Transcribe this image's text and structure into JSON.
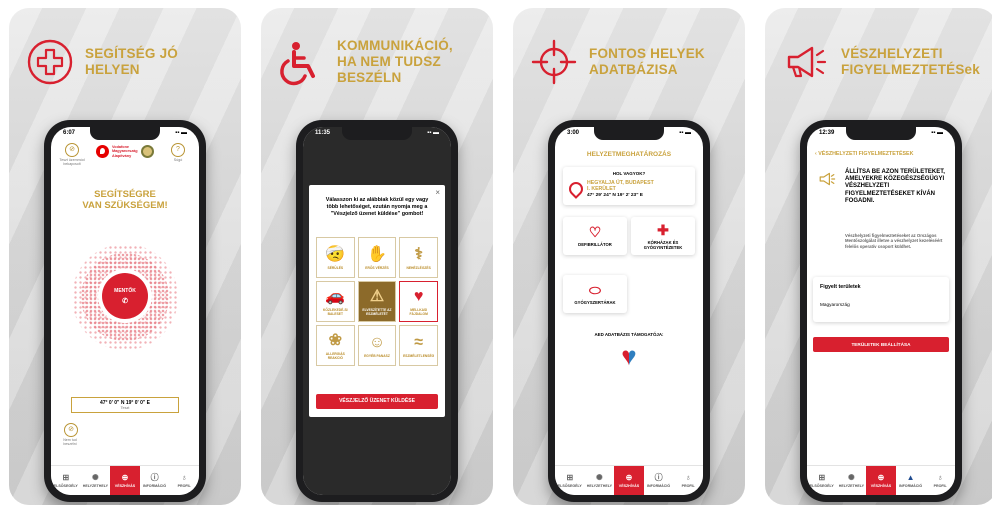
{
  "colors": {
    "gold": "#c9a23d",
    "red": "#d8202f",
    "dark": "#1d1d1f"
  },
  "panels": [
    {
      "title": "SEGÍTSÉG JÓ HELYEN",
      "icon": "first-aid-cross-icon"
    },
    {
      "title": "KOMMUNIKÁCIÓ,\nHA NEM TUDSZ\nBESZÉLN",
      "icon": "wheelchair-icon"
    },
    {
      "title": "FONTOS HELYEK\nADATBÁZISA",
      "icon": "crosshair-icon"
    },
    {
      "title": "VÉSZHELYZETI\nFIGYELMEZTETÉSek",
      "icon": "megaphone-icon"
    }
  ],
  "tabs": {
    "first": [
      "ELSŐSEGÉLY",
      "HELYZETHELY",
      "VÉSZHÍVÁS",
      "INFORMÁCIÓ",
      "PROFIL"
    ],
    "third": [
      "ELSŐSEGÉLY",
      "HELYZETHELY",
      "VÉSZHÍVÁS",
      "INFORMÁCIÓ",
      "PROFIL"
    ],
    "fourth": [
      "ELSŐSEGÉLY",
      "HELYZETHELY",
      "VÉSZHÍVÁS",
      "INFORMÁCIÓ",
      "PROFIL"
    ]
  },
  "screen1": {
    "time": "6:07",
    "left_note": "Teszt üzemmód bekapcsolt",
    "help": "?",
    "help_note": "Súgó",
    "brand": "Vodafone Magyarország Alapítvány",
    "need_1": "SEGÍTSÉGRE",
    "need_2": "VAN SZÜKSÉGEM!",
    "call": "MENTŐK",
    "coords": "47° 0' 0\" N 19° 0' 0\" E",
    "coords_sub": "Teszt",
    "mute_note": "Nem tud beszélni"
  },
  "screen2": {
    "time": "11:35",
    "close": "×",
    "prompt": "Válasszon ki az alábbiak közül egy vagy több lehetőséget, ezután nyomja meg a \"Vészjelző üzenet küldése\" gombot!",
    "options": [
      "SÉRÜLÉS",
      "ERŐS VÉRZÉS",
      "NEHÉZLÉGZÉS",
      "KÖZLEKEDÉ-SI BALESET",
      "ELVESZÍTETTE AZ ESZMÉLETÉT",
      "MELLKASI FÁJDALOM",
      "ALLERGIÁS REAKCIÓ",
      "EGYÉB PANASZ",
      "ESZMÉLETLENSÉG"
    ],
    "send": "VÉSZJELZŐ ÜZENET KÜLDÉSE"
  },
  "screen3": {
    "time": "3:00",
    "header": "HELYZETMEGHATÁROZÁS",
    "question": "HOL VAGYOK?",
    "address": "HEGYALJA ÚT, BUDAPEST\nI. KERÜLET",
    "coords": "47° 29' 24\" N 19° 2' 23\" E",
    "tile1": "DEFIBRILLÁTOR",
    "tile2": "KÓRHÁZAK ÉS\nGYÓGYINTÉZETEK",
    "tile3": "GYÓGYSZERTÁRAK",
    "aed": "AED ADATBÁZIS TÁMOGATÓJA:"
  },
  "screen4": {
    "time": "12:39",
    "header": "VÉSZHELYZETI FIGYELMEZTETÉSEK",
    "title": "ÁLLÍTSA BE AZON TERÜLETEKET, AMELYEKRE KÖZEGÉSZSÉGÜGYI VÉSZHELYZETI FIGYELMEZTETÉSEKET KÍVÁN FOGADNI.",
    "desc": "Vészhelyzeti figyelmeztetéseket az Országos Mentőszolgálat illetve a vészhelyzet kezeléséért felelős operatív csoport küldhet.",
    "watched": "Figyelt területek",
    "country": "Magyarország",
    "button": "TERÜLETEK BEÁLLÍTÁSA"
  }
}
